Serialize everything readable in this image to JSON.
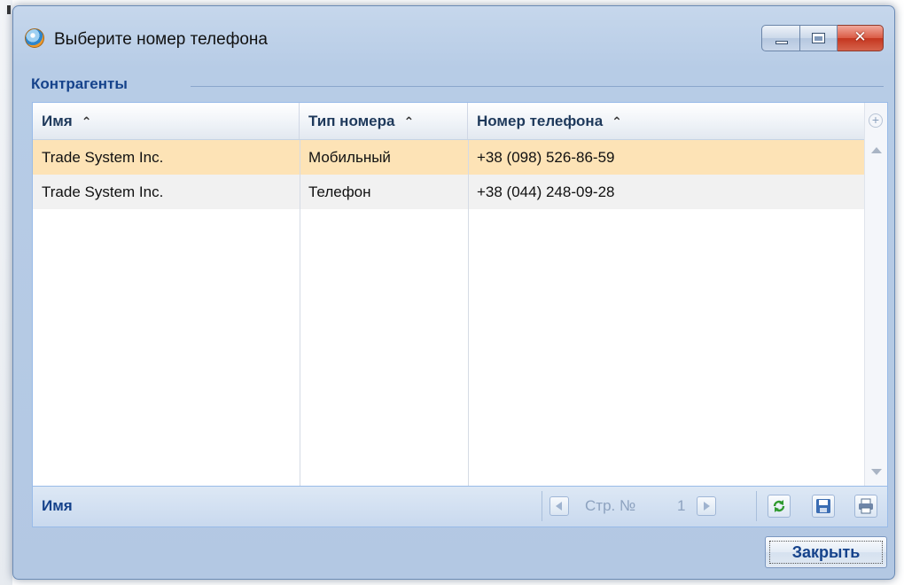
{
  "window": {
    "title": "Выберите номер телефона",
    "buttons": {
      "minimize": "minimize-icon",
      "maximize": "maximize-icon",
      "close": "close-icon"
    }
  },
  "group": {
    "title": "Контрагенты"
  },
  "grid": {
    "columns": [
      {
        "label": "Имя",
        "sort": "▲"
      },
      {
        "label": "Тип номера",
        "sort": "▲"
      },
      {
        "label": "Номер телефона",
        "sort": "▲"
      }
    ],
    "rows": [
      {
        "name": "Trade System Inc.",
        "type": "Мобильный",
        "phone": "+38 (098) 526-86-59",
        "selected": true
      },
      {
        "name": "Trade System Inc.",
        "type": "Телефон",
        "phone": "+38 (044) 248-09-28",
        "selected": false
      }
    ],
    "footer": {
      "label": "Имя",
      "page_text": "Стр. №",
      "page_number": "1"
    }
  },
  "actions": {
    "close_label": "Закрыть"
  },
  "colors": {
    "accent_text": "#15428b",
    "selected_row": "#fde3b6",
    "alt_row": "#f1f1f1",
    "close_button_red": "#c4361f"
  }
}
